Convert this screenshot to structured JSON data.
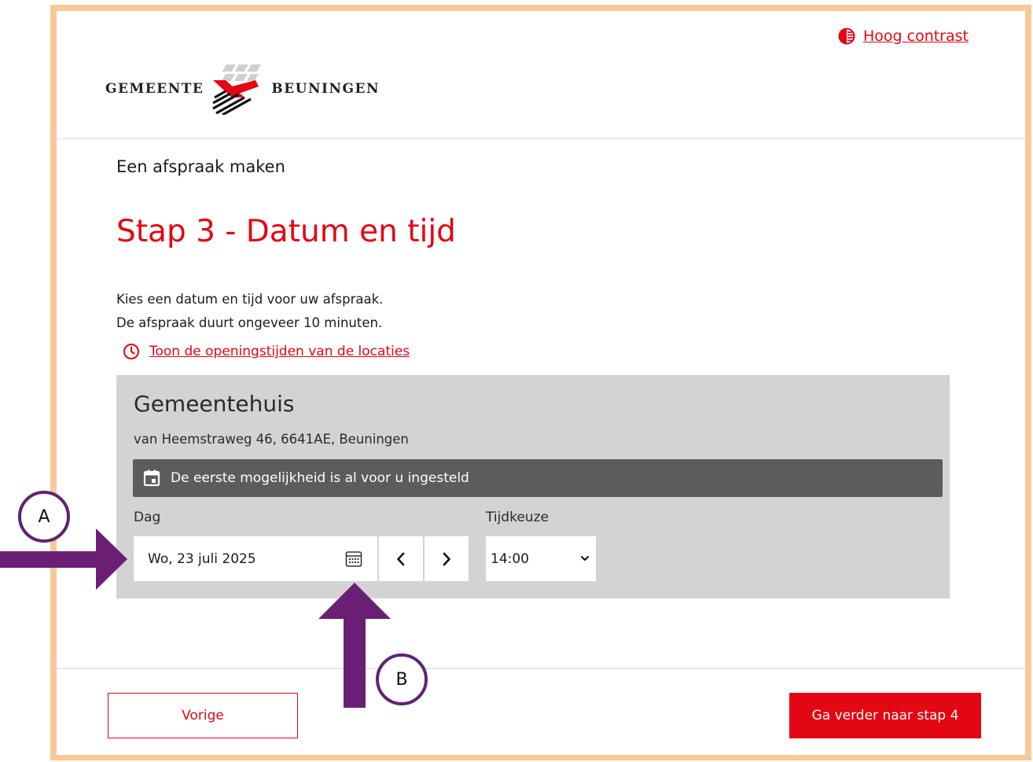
{
  "header": {
    "contrast_label": "Hoog contrast",
    "logo_left": "Gemeente",
    "logo_right": "Beuningen"
  },
  "page": {
    "eyebrow": "Een afspraak maken",
    "title": "Stap 3 - Datum en tijd",
    "intro_line1": "Kies een datum en tijd voor uw afspraak.",
    "intro_line2": "De afspraak duurt ongeveer 10 minuten.",
    "hours_link": "Toon de openingstijden van de locaties"
  },
  "location": {
    "name": "Gemeentehuis",
    "address": "van Heemstraweg 46, 6641AE, Beuningen",
    "notice": "De eerste mogelijkheid is al voor u ingesteld",
    "day_label": "Dag",
    "day_value": "Wo, 23 juli 2025",
    "time_label": "Tijdkeuze",
    "time_value": "14:00"
  },
  "footer": {
    "prev_label": "Vorige",
    "next_label": "Ga verder naar stap 4"
  },
  "annotations": {
    "marker_a": "A",
    "marker_b": "B"
  },
  "colors": {
    "brand_red": "#e30613",
    "frame": "#f5c998",
    "annotation_purple": "#6a1f74",
    "panel_gray": "#d4d3d4",
    "notice_gray": "#5c5c5c"
  },
  "icons": {
    "contrast": "half-circle-contrast-icon",
    "clock": "clock-icon",
    "calendar_notice": "calendar-icon",
    "date_picker": "calendar-grid-icon",
    "prev_day": "chevron-left-icon",
    "next_day": "chevron-right-icon",
    "select": "chevron-down-icon"
  }
}
